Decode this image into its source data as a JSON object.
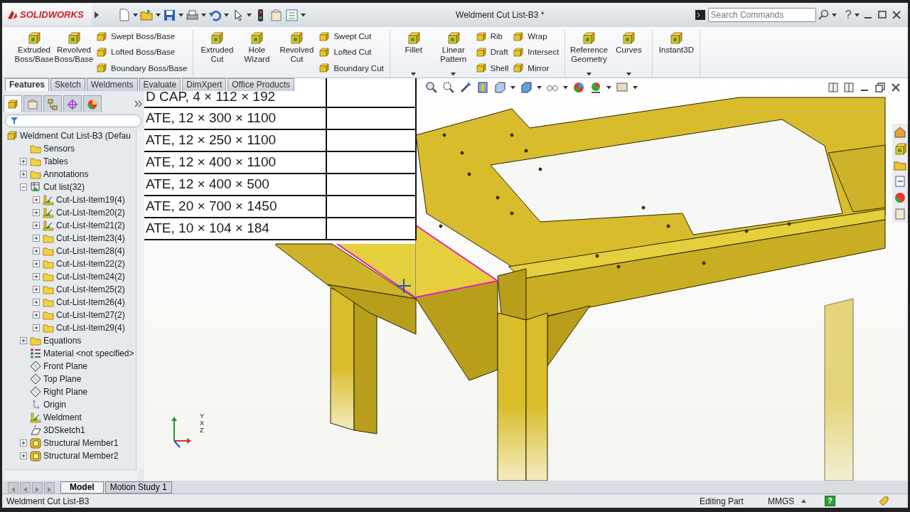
{
  "window": {
    "title": "Weldment Cut List-B3 *"
  },
  "app": {
    "logo": "SOLIDWORKS"
  },
  "search": {
    "placeholder": "Search Commands"
  },
  "help": {
    "glyph": "?"
  },
  "ribbon": {
    "groups": [
      {
        "items": [
          {
            "kind": "large",
            "label": "Extruded Boss/Base",
            "dropdown": false
          },
          {
            "kind": "large",
            "label": "Revolved Boss/Base",
            "dropdown": false
          },
          {
            "kind": "stack",
            "items": [
              {
                "label": "Swept Boss/Base"
              },
              {
                "label": "Lofted Boss/Base"
              },
              {
                "label": "Boundary Boss/Base"
              }
            ]
          }
        ]
      },
      {
        "items": [
          {
            "kind": "large",
            "label": "Extruded Cut",
            "dropdown": false
          },
          {
            "kind": "large",
            "label": "Hole Wizard",
            "dropdown": false
          },
          {
            "kind": "large",
            "label": "Revolved Cut",
            "dropdown": false
          },
          {
            "kind": "stack",
            "items": [
              {
                "label": "Swept Cut"
              },
              {
                "label": "Lofted Cut"
              },
              {
                "label": "Boundary Cut"
              }
            ]
          }
        ]
      },
      {
        "items": [
          {
            "kind": "large",
            "label": "Fillet",
            "dropdown": true
          },
          {
            "kind": "large",
            "label": "Linear Pattern",
            "dropdown": true
          },
          {
            "kind": "stack",
            "items": [
              {
                "label": "Rib"
              },
              {
                "label": "Draft"
              },
              {
                "label": "Shell"
              }
            ]
          },
          {
            "kind": "stack",
            "items": [
              {
                "label": "Wrap"
              },
              {
                "label": "Intersect"
              },
              {
                "label": "Mirror"
              }
            ]
          }
        ]
      },
      {
        "items": [
          {
            "kind": "large",
            "label": "Reference Geometry",
            "dropdown": true
          },
          {
            "kind": "large",
            "label": "Curves",
            "dropdown": true
          }
        ]
      },
      {
        "items": [
          {
            "kind": "large",
            "label": "Instant3D",
            "dropdown": false
          }
        ]
      }
    ]
  },
  "command_tabs": [
    {
      "label": "Features",
      "selected": true
    },
    {
      "label": "Sketch",
      "selected": false
    },
    {
      "label": "Weldments",
      "selected": false
    },
    {
      "label": "Evaluate",
      "selected": false
    },
    {
      "label": "DimXpert",
      "selected": false
    },
    {
      "label": "Office Products",
      "selected": false
    }
  ],
  "panel_tabs": [
    {
      "selected": true
    },
    {
      "selected": false
    },
    {
      "selected": false
    },
    {
      "selected": false
    },
    {
      "selected": false
    }
  ],
  "tree": {
    "items": [
      {
        "label": "Weldment Cut List-B3  (Defau",
        "kind": "part",
        "children": [
          {
            "label": "Sensors",
            "kind": "sensors"
          },
          {
            "label": "Tables",
            "kind": "tables",
            "expanded": false
          },
          {
            "label": "Annotations",
            "kind": "annotations",
            "expanded": false
          },
          {
            "label": "Cut list(32)",
            "kind": "cutlist",
            "expanded": true,
            "children": [
              {
                "label": "Cut-List-Item19(4)",
                "kind": "weldment",
                "expanded": false
              },
              {
                "label": "Cut-List-Item20(2)",
                "kind": "weldment",
                "expanded": false
              },
              {
                "label": "Cut-List-Item21(2)",
                "kind": "weldment",
                "expanded": false
              },
              {
                "label": "Cut-List-Item23(4)",
                "kind": "folder",
                "expanded": false
              },
              {
                "label": "Cut-List-Item28(4)",
                "kind": "folder",
                "expanded": false
              },
              {
                "label": "Cut-List-Item22(2)",
                "kind": "folder",
                "expanded": false
              },
              {
                "label": "Cut-List-Item24(2)",
                "kind": "folder",
                "expanded": false
              },
              {
                "label": "Cut-List-Item25(2)",
                "kind": "folder",
                "expanded": false
              },
              {
                "label": "Cut-List-Item26(4)",
                "kind": "folder",
                "expanded": false
              },
              {
                "label": "Cut-List-Item27(2)",
                "kind": "folder",
                "expanded": false
              },
              {
                "label": "Cut-List-Item29(4)",
                "kind": "folder",
                "expanded": false
              }
            ]
          },
          {
            "label": "Equations",
            "kind": "equations",
            "expanded": false
          },
          {
            "label": "Material <not specified>",
            "kind": "material"
          },
          {
            "label": "Front Plane",
            "kind": "plane"
          },
          {
            "label": "Top Plane",
            "kind": "plane"
          },
          {
            "label": "Right Plane",
            "kind": "plane"
          },
          {
            "label": "Origin",
            "kind": "origin"
          },
          {
            "label": "Weldment",
            "kind": "weldment"
          },
          {
            "label": "3DSketch1",
            "kind": "sketch"
          },
          {
            "label": "Structural Member1",
            "kind": "structural",
            "expanded": false
          },
          {
            "label": "Structural Member2",
            "kind": "structural",
            "expanded": false
          }
        ]
      }
    ]
  },
  "cut_list_table": {
    "rows": [
      "D CAP, 4 × 112 × 192",
      "ATE, 12 × 300 × 1100",
      "ATE, 12 × 250 × 1100",
      "ATE, 12 × 400 × 1100",
      "ATE, 12 × 400 × 500",
      "ATE, 20 × 700 × 1450",
      "ATE, 10 × 104 × 184"
    ]
  },
  "triad": {
    "x": "X",
    "y": "Y",
    "z": "Z"
  },
  "model_tabs": [
    {
      "label": "Model",
      "selected": true
    },
    {
      "label": "Motion Study 1",
      "selected": false
    }
  ],
  "status_bar": {
    "document": "Weldment Cut List-B3",
    "mode": "Editing Part",
    "units": "MMGS",
    "help_glyph": "?"
  }
}
